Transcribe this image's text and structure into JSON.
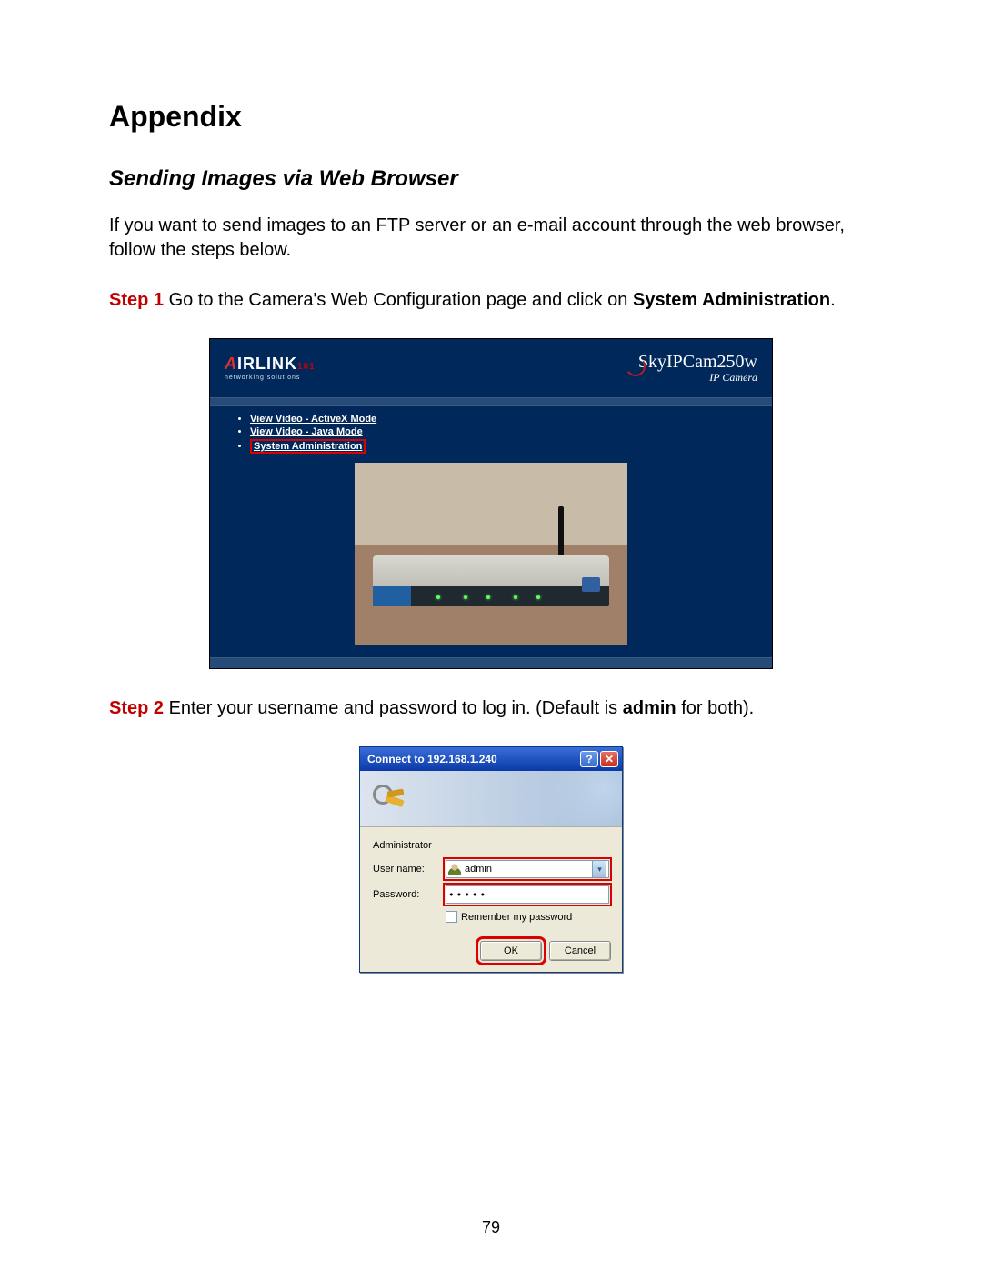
{
  "heading": "Appendix",
  "subheading": "Sending Images via Web Browser",
  "intro": "If you want to send images to an FTP server or an e-mail account through the web browser, follow the steps below.",
  "step1": {
    "label": "Step 1",
    "text_a": " Go to the Camera's Web Configuration page and click on ",
    "bold_a": "System Administration",
    "text_b": "."
  },
  "camera_page": {
    "logo_main_a": "A",
    "logo_main_b": "IRLINK",
    "logo_101": "101",
    "logo_sub": "networking solutions",
    "product_name": "SkyIPCam250w",
    "product_sub": "IP Camera",
    "links": {
      "activex": "View Video - ActiveX Mode",
      "java": "View Video - Java Mode",
      "sysadmin": "System Administration"
    }
  },
  "step2": {
    "label": "Step 2",
    "text_a": " Enter your username and password to log in. (Default is ",
    "bold_a": "admin",
    "text_b": " for both)."
  },
  "dialog": {
    "title": "Connect to 192.168.1.240",
    "help_symbol": "?",
    "close_symbol": "✕",
    "realm": "Administrator",
    "user_label": "User name:",
    "user_value": "admin",
    "dropdown_symbol": "▾",
    "pass_label": "Password:",
    "pass_value": "•••••",
    "remember": "Remember my password",
    "ok": "OK",
    "cancel": "Cancel"
  },
  "page_number": "79"
}
